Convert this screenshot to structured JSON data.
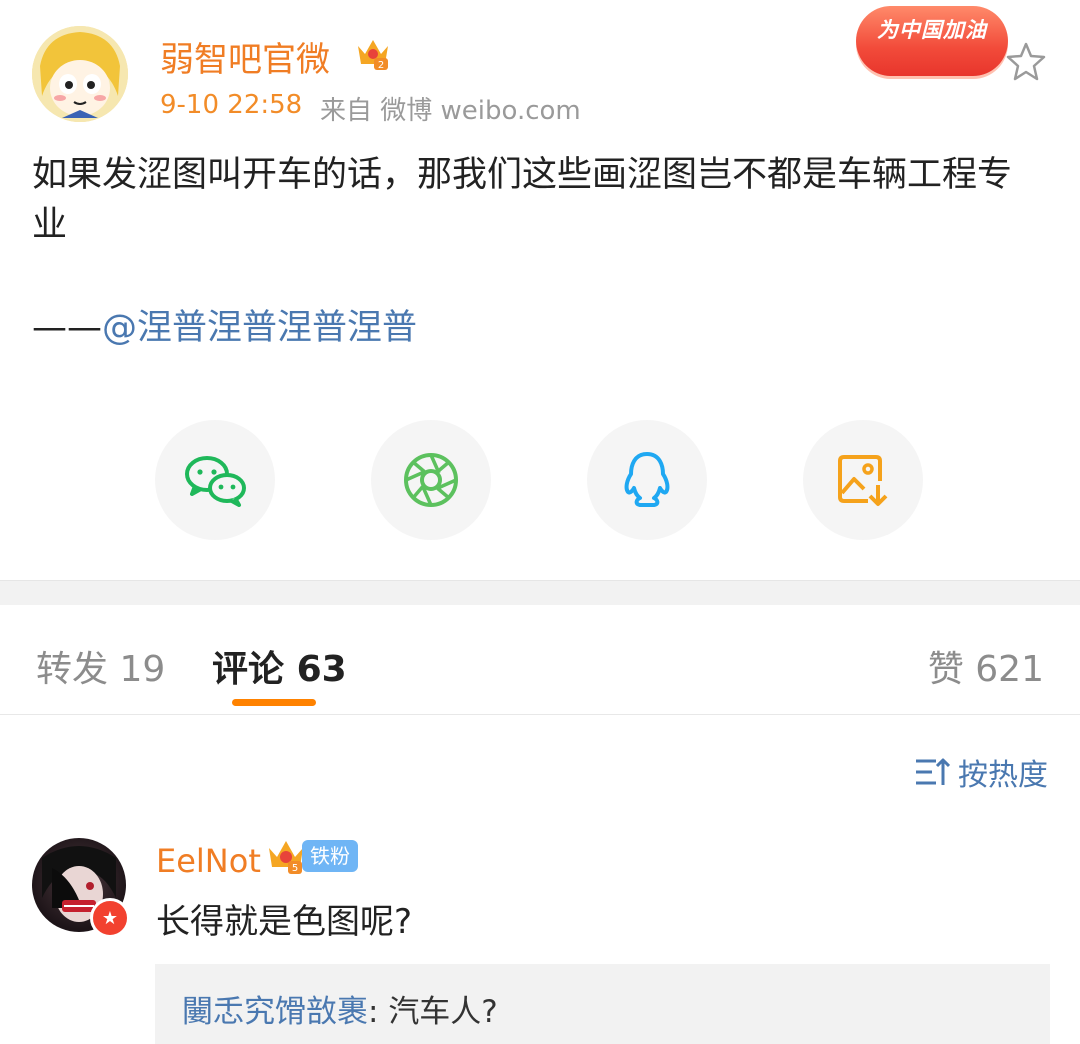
{
  "post": {
    "author": "弱智吧官微",
    "time": "9-10 22:58",
    "source": "来自 微博 weibo.com",
    "badge": "为中国加油",
    "text": "如果发涩图叫开车的话，那我们这些画涩图岂不都是车辆工程专业",
    "quote_prefix": "——",
    "quote_mention": "@涅普涅普涅普涅普"
  },
  "share": {
    "items": [
      "wechat-icon",
      "moments-icon",
      "qq-icon",
      "save-image-icon"
    ]
  },
  "tabs": {
    "forward_label": "转发",
    "forward_count": "19",
    "comment_label": "评论",
    "comment_count": "63",
    "like_label": "赞",
    "like_count": "621"
  },
  "sort": {
    "label": "按热度"
  },
  "comment": {
    "name": "EelNot",
    "fan_badge": "铁粉",
    "text": "长得就是色图呢?",
    "reply_name": "闄忎究馉敨裹",
    "reply_sep": ":",
    "reply_text": "汽车人?"
  },
  "colors": {
    "accent": "#ff8200",
    "name": "#f07d24",
    "link": "#4a78b0"
  }
}
